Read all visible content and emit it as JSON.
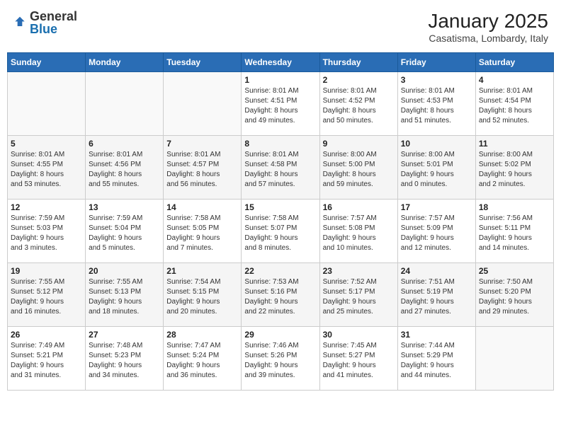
{
  "header": {
    "logo_general": "General",
    "logo_blue": "Blue",
    "month": "January 2025",
    "location": "Casatisma, Lombardy, Italy"
  },
  "days_of_week": [
    "Sunday",
    "Monday",
    "Tuesday",
    "Wednesday",
    "Thursday",
    "Friday",
    "Saturday"
  ],
  "weeks": [
    [
      {
        "day": "",
        "info": ""
      },
      {
        "day": "",
        "info": ""
      },
      {
        "day": "",
        "info": ""
      },
      {
        "day": "1",
        "info": "Sunrise: 8:01 AM\nSunset: 4:51 PM\nDaylight: 8 hours\nand 49 minutes."
      },
      {
        "day": "2",
        "info": "Sunrise: 8:01 AM\nSunset: 4:52 PM\nDaylight: 8 hours\nand 50 minutes."
      },
      {
        "day": "3",
        "info": "Sunrise: 8:01 AM\nSunset: 4:53 PM\nDaylight: 8 hours\nand 51 minutes."
      },
      {
        "day": "4",
        "info": "Sunrise: 8:01 AM\nSunset: 4:54 PM\nDaylight: 8 hours\nand 52 minutes."
      }
    ],
    [
      {
        "day": "5",
        "info": "Sunrise: 8:01 AM\nSunset: 4:55 PM\nDaylight: 8 hours\nand 53 minutes."
      },
      {
        "day": "6",
        "info": "Sunrise: 8:01 AM\nSunset: 4:56 PM\nDaylight: 8 hours\nand 55 minutes."
      },
      {
        "day": "7",
        "info": "Sunrise: 8:01 AM\nSunset: 4:57 PM\nDaylight: 8 hours\nand 56 minutes."
      },
      {
        "day": "8",
        "info": "Sunrise: 8:01 AM\nSunset: 4:58 PM\nDaylight: 8 hours\nand 57 minutes."
      },
      {
        "day": "9",
        "info": "Sunrise: 8:00 AM\nSunset: 5:00 PM\nDaylight: 8 hours\nand 59 minutes."
      },
      {
        "day": "10",
        "info": "Sunrise: 8:00 AM\nSunset: 5:01 PM\nDaylight: 9 hours\nand 0 minutes."
      },
      {
        "day": "11",
        "info": "Sunrise: 8:00 AM\nSunset: 5:02 PM\nDaylight: 9 hours\nand 2 minutes."
      }
    ],
    [
      {
        "day": "12",
        "info": "Sunrise: 7:59 AM\nSunset: 5:03 PM\nDaylight: 9 hours\nand 3 minutes."
      },
      {
        "day": "13",
        "info": "Sunrise: 7:59 AM\nSunset: 5:04 PM\nDaylight: 9 hours\nand 5 minutes."
      },
      {
        "day": "14",
        "info": "Sunrise: 7:58 AM\nSunset: 5:05 PM\nDaylight: 9 hours\nand 7 minutes."
      },
      {
        "day": "15",
        "info": "Sunrise: 7:58 AM\nSunset: 5:07 PM\nDaylight: 9 hours\nand 8 minutes."
      },
      {
        "day": "16",
        "info": "Sunrise: 7:57 AM\nSunset: 5:08 PM\nDaylight: 9 hours\nand 10 minutes."
      },
      {
        "day": "17",
        "info": "Sunrise: 7:57 AM\nSunset: 5:09 PM\nDaylight: 9 hours\nand 12 minutes."
      },
      {
        "day": "18",
        "info": "Sunrise: 7:56 AM\nSunset: 5:11 PM\nDaylight: 9 hours\nand 14 minutes."
      }
    ],
    [
      {
        "day": "19",
        "info": "Sunrise: 7:55 AM\nSunset: 5:12 PM\nDaylight: 9 hours\nand 16 minutes."
      },
      {
        "day": "20",
        "info": "Sunrise: 7:55 AM\nSunset: 5:13 PM\nDaylight: 9 hours\nand 18 minutes."
      },
      {
        "day": "21",
        "info": "Sunrise: 7:54 AM\nSunset: 5:15 PM\nDaylight: 9 hours\nand 20 minutes."
      },
      {
        "day": "22",
        "info": "Sunrise: 7:53 AM\nSunset: 5:16 PM\nDaylight: 9 hours\nand 22 minutes."
      },
      {
        "day": "23",
        "info": "Sunrise: 7:52 AM\nSunset: 5:17 PM\nDaylight: 9 hours\nand 25 minutes."
      },
      {
        "day": "24",
        "info": "Sunrise: 7:51 AM\nSunset: 5:19 PM\nDaylight: 9 hours\nand 27 minutes."
      },
      {
        "day": "25",
        "info": "Sunrise: 7:50 AM\nSunset: 5:20 PM\nDaylight: 9 hours\nand 29 minutes."
      }
    ],
    [
      {
        "day": "26",
        "info": "Sunrise: 7:49 AM\nSunset: 5:21 PM\nDaylight: 9 hours\nand 31 minutes."
      },
      {
        "day": "27",
        "info": "Sunrise: 7:48 AM\nSunset: 5:23 PM\nDaylight: 9 hours\nand 34 minutes."
      },
      {
        "day": "28",
        "info": "Sunrise: 7:47 AM\nSunset: 5:24 PM\nDaylight: 9 hours\nand 36 minutes."
      },
      {
        "day": "29",
        "info": "Sunrise: 7:46 AM\nSunset: 5:26 PM\nDaylight: 9 hours\nand 39 minutes."
      },
      {
        "day": "30",
        "info": "Sunrise: 7:45 AM\nSunset: 5:27 PM\nDaylight: 9 hours\nand 41 minutes."
      },
      {
        "day": "31",
        "info": "Sunrise: 7:44 AM\nSunset: 5:29 PM\nDaylight: 9 hours\nand 44 minutes."
      },
      {
        "day": "",
        "info": ""
      }
    ]
  ]
}
